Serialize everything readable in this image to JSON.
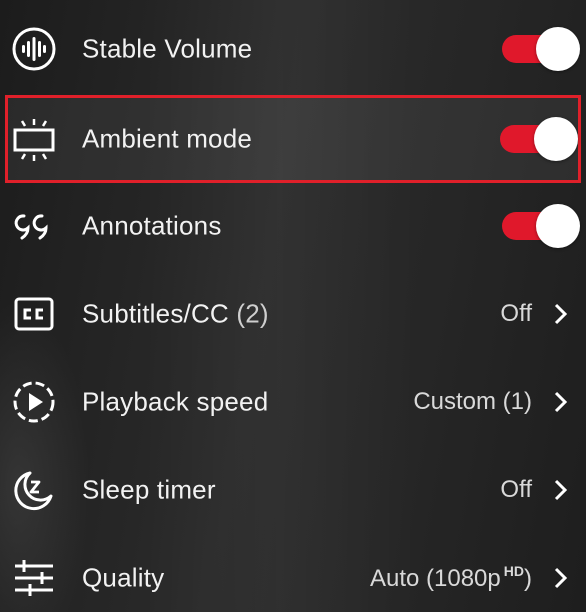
{
  "menu": {
    "items": [
      {
        "label": "Stable Volume",
        "icon": "stable-volume-icon",
        "control": "toggle",
        "on": true
      },
      {
        "label": "Ambient mode",
        "icon": "ambient-mode-icon",
        "control": "toggle",
        "on": true,
        "highlighted": true
      },
      {
        "label": "Annotations",
        "icon": "annotations-icon",
        "control": "toggle",
        "on": true
      },
      {
        "label": "Subtitles/CC",
        "count": "(2)",
        "icon": "closed-captions-icon",
        "control": "chevron",
        "value": "Off"
      },
      {
        "label": "Playback speed",
        "icon": "playback-speed-icon",
        "control": "chevron",
        "value": "Custom (1)"
      },
      {
        "label": "Sleep timer",
        "icon": "sleep-timer-icon",
        "control": "chevron",
        "value": "Off"
      },
      {
        "label": "Quality",
        "icon": "quality-settings-icon",
        "control": "chevron",
        "value": "Auto (1080p",
        "value_sup": "HD",
        "value_suffix": ")"
      }
    ]
  },
  "colors": {
    "toggle_track": "#e0182b",
    "toggle_knob": "#ffffff",
    "highlight_border": "#e0202a"
  }
}
